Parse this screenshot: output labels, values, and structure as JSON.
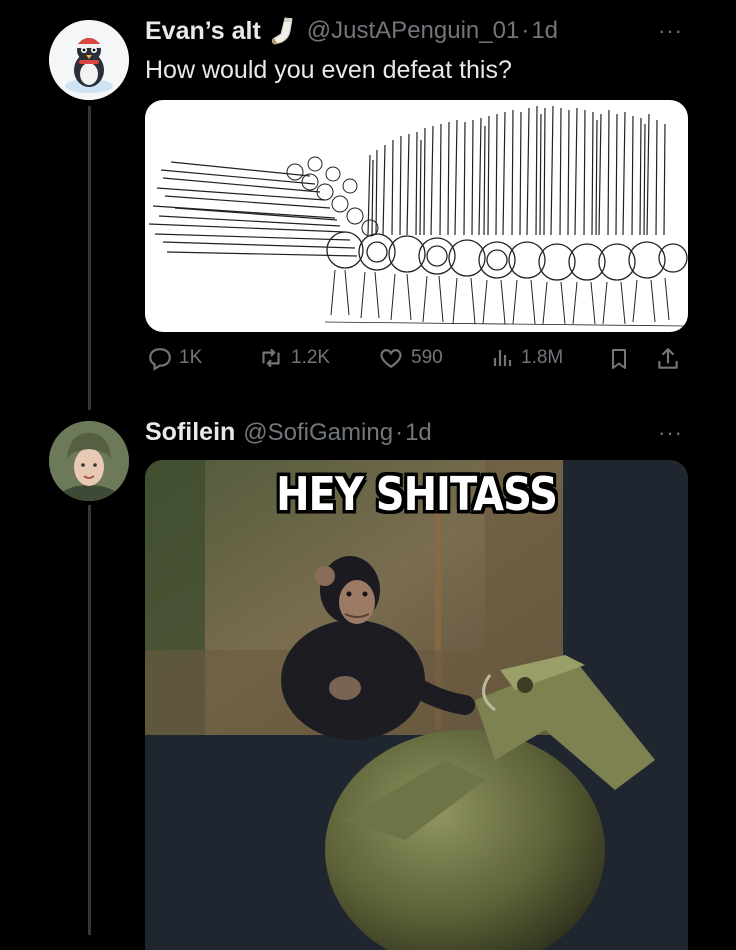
{
  "tweet1": {
    "display_name": "Evan’s alt",
    "handle": "@JustAPenguin_01",
    "separator": "·",
    "time": "1d",
    "text": "How would you even defeat this?",
    "avatar_icon": "penguin-avatar-icon",
    "name_emoji_icon": "sock-icon",
    "more_label": "···",
    "image_signature": "",
    "actions": {
      "replies": "1K",
      "reposts": "1.2K",
      "likes": "590",
      "views": "1.8M"
    }
  },
  "tweet2": {
    "display_name": "Sofilein",
    "handle": "@SofiGaming",
    "separator": "·",
    "time": "1d",
    "more_label": "···",
    "avatar_icon": "profile-photo-avatar",
    "meme_caption": "HEY SHITASS"
  },
  "colors": {
    "background": "#000000",
    "primary_text": "#e7e9ea",
    "secondary_text": "#71767b",
    "thread_line": "#333639"
  }
}
